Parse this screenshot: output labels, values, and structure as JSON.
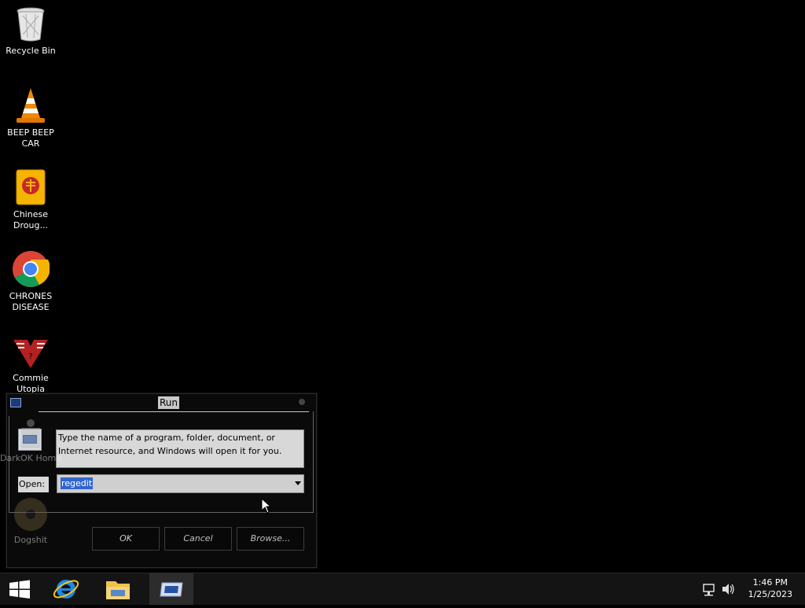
{
  "desktop": {
    "icons": [
      {
        "label": "Recycle Bin",
        "icon": "recycle-bin-icon"
      },
      {
        "label": "BEEP BEEP CAR",
        "icon": "vlc-cone-icon"
      },
      {
        "label": "Chinese Droug...",
        "icon": "chinese-book-icon"
      },
      {
        "label": "CHRONES DISEASE",
        "icon": "chrome-icon"
      },
      {
        "label": "Commie Utopia",
        "icon": "papers-please-icon"
      },
      {
        "label": "DarkOK Home",
        "icon": "program-icon"
      },
      {
        "label": "Dogshit",
        "icon": "disc-icon"
      }
    ]
  },
  "run_dialog": {
    "title": "Run",
    "description": "Type the name of a program, folder, document, or Internet resource, and Windows will open it for you.",
    "open_label": "Open:",
    "input_value": "regedit",
    "buttons": {
      "ok": "OK",
      "cancel": "Cancel",
      "browse": "Browse..."
    }
  },
  "taskbar": {
    "items": [
      {
        "name": "start",
        "icon": "windows-logo-icon"
      },
      {
        "name": "internet-explorer",
        "icon": "internet-explorer-icon"
      },
      {
        "name": "file-explorer",
        "icon": "folder-icon"
      },
      {
        "name": "run",
        "icon": "run-icon",
        "active": true
      }
    ],
    "clock": {
      "time": "1:46 PM",
      "date": "1/25/2023"
    }
  },
  "colors": {
    "desktop_bg": "#000000",
    "taskbar_bg": "#141414",
    "selection": "#3366cc"
  }
}
